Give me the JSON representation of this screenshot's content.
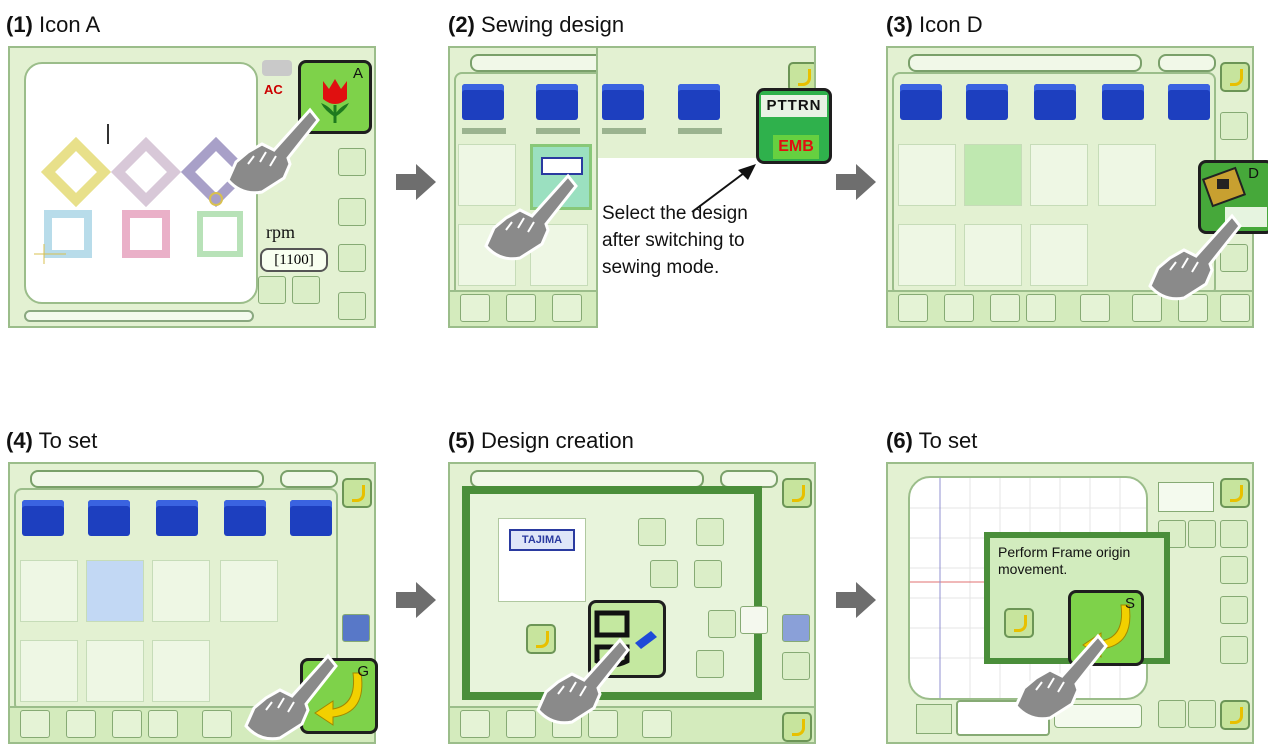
{
  "steps": [
    {
      "number": "(1)",
      "label": "Icon A",
      "icon_letter": "A"
    },
    {
      "number": "(2)",
      "label": "Sewing design",
      "icon_text_top": "PTTRN",
      "icon_text_bottom": "EMB"
    },
    {
      "number": "(3)",
      "label": "Icon D",
      "icon_letter": "D"
    },
    {
      "number": "(4)",
      "label": "To set",
      "icon_letter": "G"
    },
    {
      "number": "(5)",
      "label": "Design creation"
    },
    {
      "number": "(6)",
      "label": "To set",
      "icon_letter": "S"
    }
  ],
  "note_step2": [
    "Select the design",
    "after switching to",
    "sewing mode."
  ],
  "panel1": {
    "rpm_label": "rpm",
    "speed_value": "[1100]",
    "ac_label": "AC"
  },
  "panel5": {
    "brand": "TAJIMA"
  },
  "panel6": {
    "popup_lines": [
      "Perform Frame origin",
      "movement."
    ]
  },
  "colors": {
    "panel_bg": "#e3f1d2",
    "panel_border": "#9bbd8a",
    "icon_green": "#7ed24a",
    "folder_blue": "#1d3fbf",
    "arrow_gray": "#6e6e6e"
  }
}
